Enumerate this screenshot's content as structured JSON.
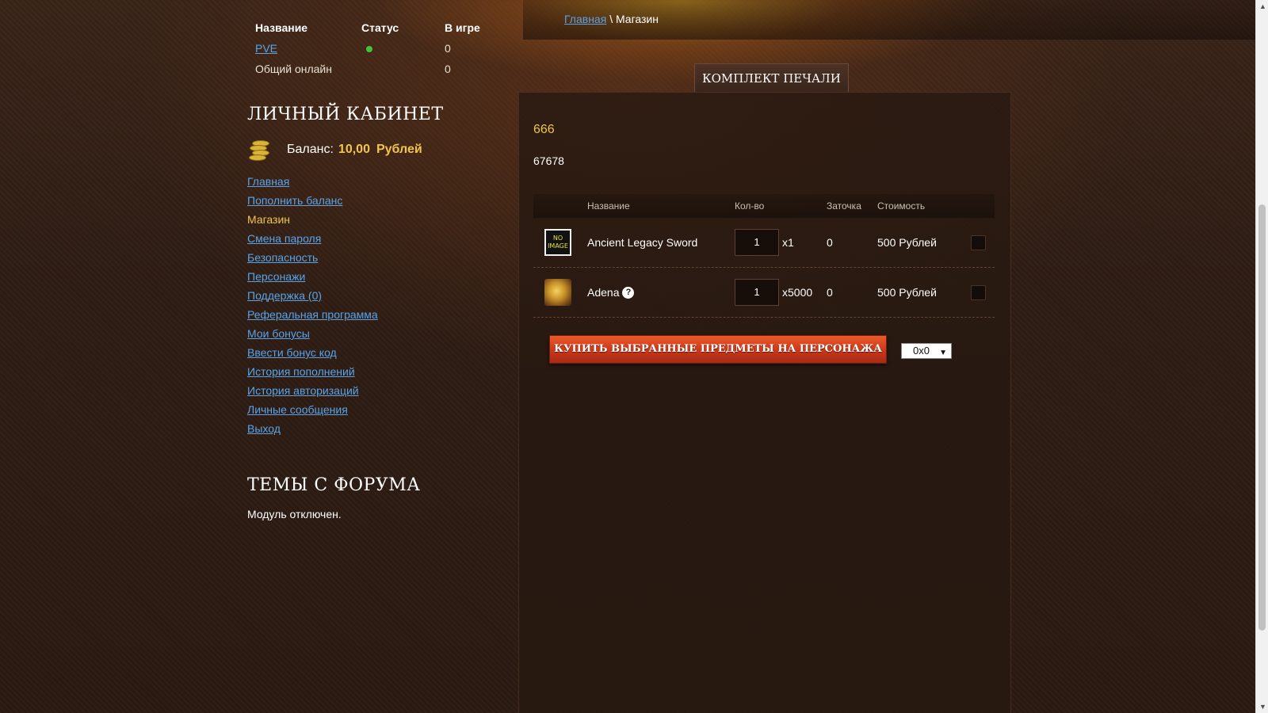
{
  "servers": {
    "headers": [
      "Название",
      "Статус",
      "В игре"
    ],
    "rows": [
      {
        "name": "PVE",
        "status": "online",
        "players": "0"
      },
      {
        "name": "Общий онлайн",
        "players": "0"
      }
    ]
  },
  "sidebar": {
    "cabinet_title": "ЛИЧНЫЙ КАБИНЕТ",
    "balance_label": "Баланс:",
    "balance_amount": "10,00",
    "balance_currency": "Рублей",
    "menu": [
      {
        "label": "Главная",
        "active": false
      },
      {
        "label": "Пополнить баланс",
        "active": false
      },
      {
        "label": "Магазин",
        "active": true
      },
      {
        "label": "Смена пароля",
        "active": false
      },
      {
        "label": "Безопасность",
        "active": false
      },
      {
        "label": "Персонажи",
        "active": false
      },
      {
        "label": "Поддержка (0)",
        "active": false
      },
      {
        "label": "Реферальная программа",
        "active": false
      },
      {
        "label": "Мои бонусы",
        "active": false
      },
      {
        "label": "Ввести бонус код",
        "active": false
      },
      {
        "label": "История пополнений",
        "active": false
      },
      {
        "label": "История авторизаций",
        "active": false
      },
      {
        "label": "Личные сообщения",
        "active": false
      },
      {
        "label": "Выход",
        "active": false
      }
    ],
    "forum_title": "ТЕМЫ С ФОРУМА",
    "forum_note": "Модуль отключен."
  },
  "breadcrumb": {
    "home": "Главная",
    "separator": "\\",
    "current": "Магазин"
  },
  "shop": {
    "tab_label": "КОМПЛЕКТ ПЕЧАЛИ",
    "title": "666",
    "description": "67678",
    "columns": [
      "Название",
      "Кол-во",
      "Заточка",
      "Стоимость"
    ],
    "items": [
      {
        "icon": "no-image-icon",
        "icon_text": "NO IMAGE",
        "name": "Ancient Legacy Sword",
        "qty": "1",
        "multiplier": "x1",
        "enchant": "0",
        "cost": "500 Рублей",
        "has_help": false
      },
      {
        "icon": "adena-icon",
        "name": "Adena",
        "qty": "1",
        "multiplier": "x5000",
        "enchant": "0",
        "cost": "500 Рублей",
        "has_help": true
      }
    ],
    "buy_button": "КУПИТЬ ВЫБРАННЫЕ ПРЕДМЕТЫ НА ПЕРСОНАЖА",
    "character_select": "0x0",
    "help_glyph": "?"
  },
  "colors": {
    "accent_gold": "#f0c64a",
    "link_blue": "#5ba3e6",
    "buy_button": "#c8371a",
    "status_online": "#45c33b"
  }
}
